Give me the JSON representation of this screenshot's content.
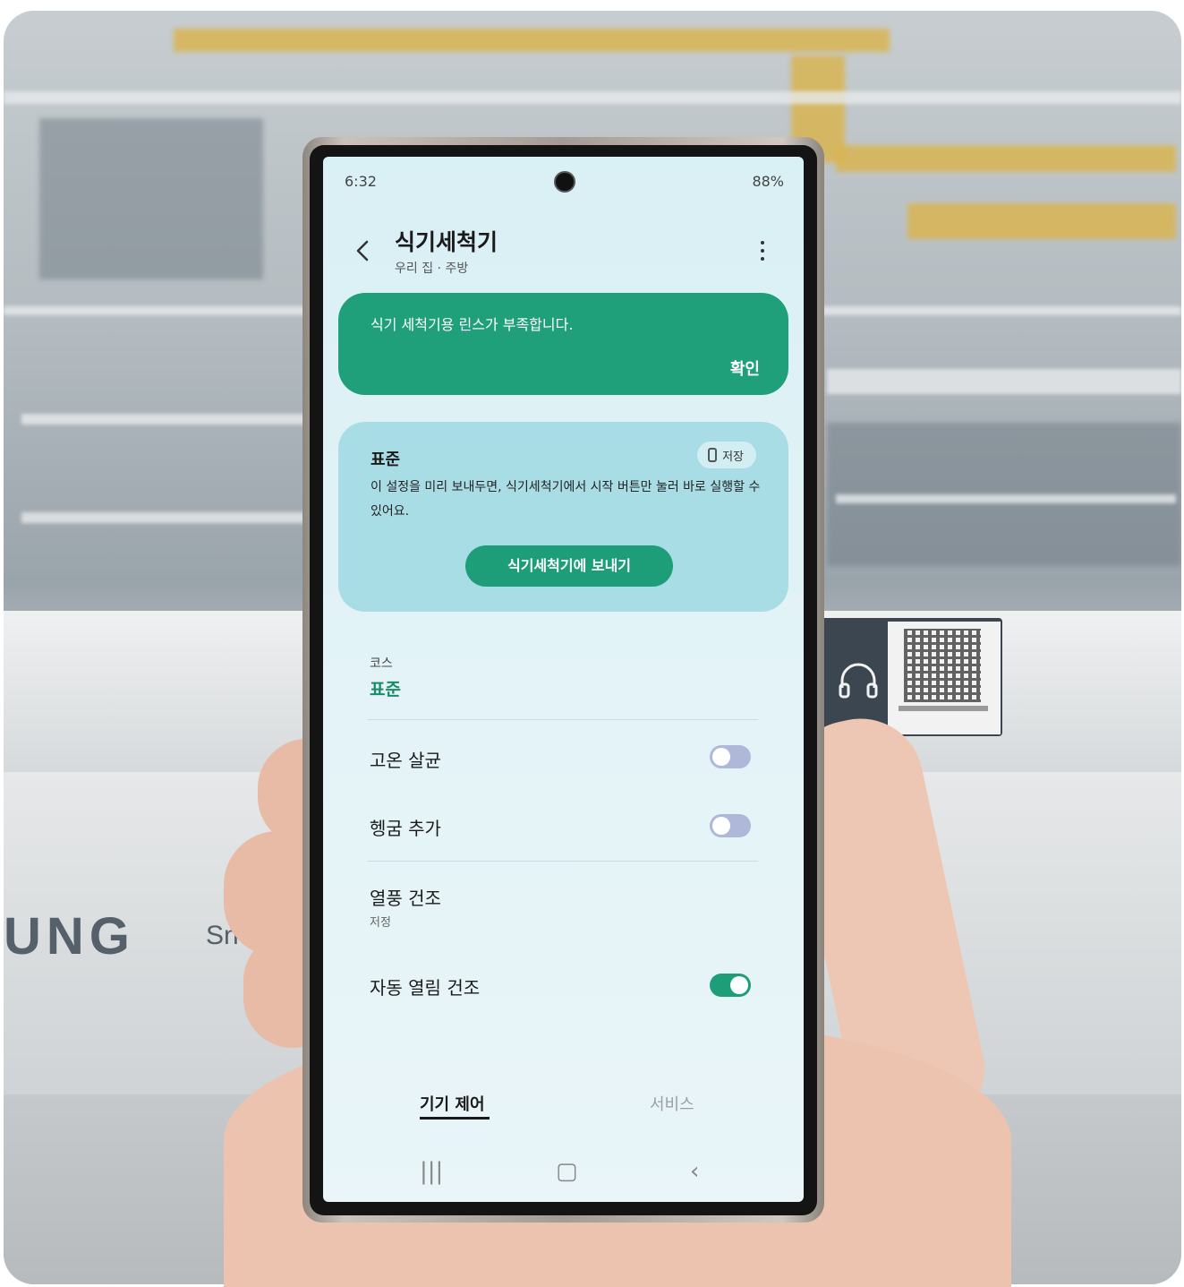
{
  "phone": {
    "status": {
      "time": "6:32",
      "right": "88%"
    },
    "header": {
      "title": "식기세척기",
      "subtitle": "우리 집 · 주방"
    },
    "alert": {
      "message": "식기 세척기용 린스가 부족합니다.",
      "confirm_label": "확인"
    },
    "preset_card": {
      "title": "표준",
      "chip_label": "저장",
      "description": "이 설정을 미리 보내두면, 식기세척기에서 시작 버튼만 눌러 바로 실행할 수 있어요.",
      "send_label": "식기세척기에 보내기"
    },
    "course": {
      "label": "코스",
      "value": "표준"
    },
    "options": [
      {
        "label": "고온 살균",
        "on": false
      },
      {
        "label": "헹굼 추가",
        "on": false
      },
      {
        "label": "열풍 건조",
        "sub": "저정"
      },
      {
        "label": "자동 열림 건조",
        "on": true
      }
    ],
    "tabs": [
      "기기 제어",
      "서비스"
    ],
    "nav": {
      "recents": "|||",
      "home": "▢",
      "back": "‹"
    }
  },
  "background": {
    "brand": "UNG",
    "brand_sub": "Sn"
  },
  "colors": {
    "accent": "#1d9e79",
    "screen_bg": "#e3f3f7",
    "card_bg": "#a9dde6"
  }
}
